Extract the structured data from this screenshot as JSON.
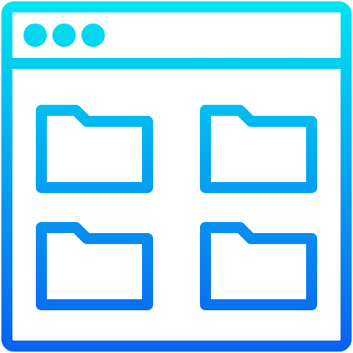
{
  "icon": {
    "name": "browser-window-folders-icon",
    "gradient": {
      "top": "#00E5F0",
      "bottom": "#0A60F0"
    },
    "window_dots": [
      "dot-icon",
      "dot-icon",
      "dot-icon"
    ],
    "folders": [
      "folder-icon",
      "folder-icon",
      "folder-icon",
      "folder-icon"
    ]
  }
}
